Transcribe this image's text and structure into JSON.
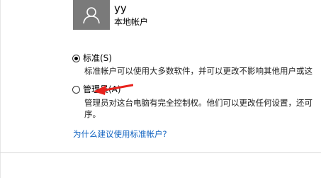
{
  "account": {
    "name": "yy",
    "type": "本地帐户"
  },
  "options": [
    {
      "label": "标准(S)",
      "checked": true,
      "description": [
        "标准帐户可以使用大多数软件，并可以更改不影响其他用户或这"
      ]
    },
    {
      "label": "管理员(A)",
      "checked": false,
      "description": [
        "管理员对这台电脑有完全控制权。他们可以更改任何设置，还可",
        "序。"
      ]
    }
  ],
  "help_link": "为什么建议使用标准帐户?",
  "colors": {
    "avatar_bg": "#7a7a7a",
    "link": "#0f62c0",
    "arrow": "#e8211c"
  },
  "icons": {
    "avatar": "user-silhouette-icon",
    "annotation": "red-arrow-icon"
  }
}
